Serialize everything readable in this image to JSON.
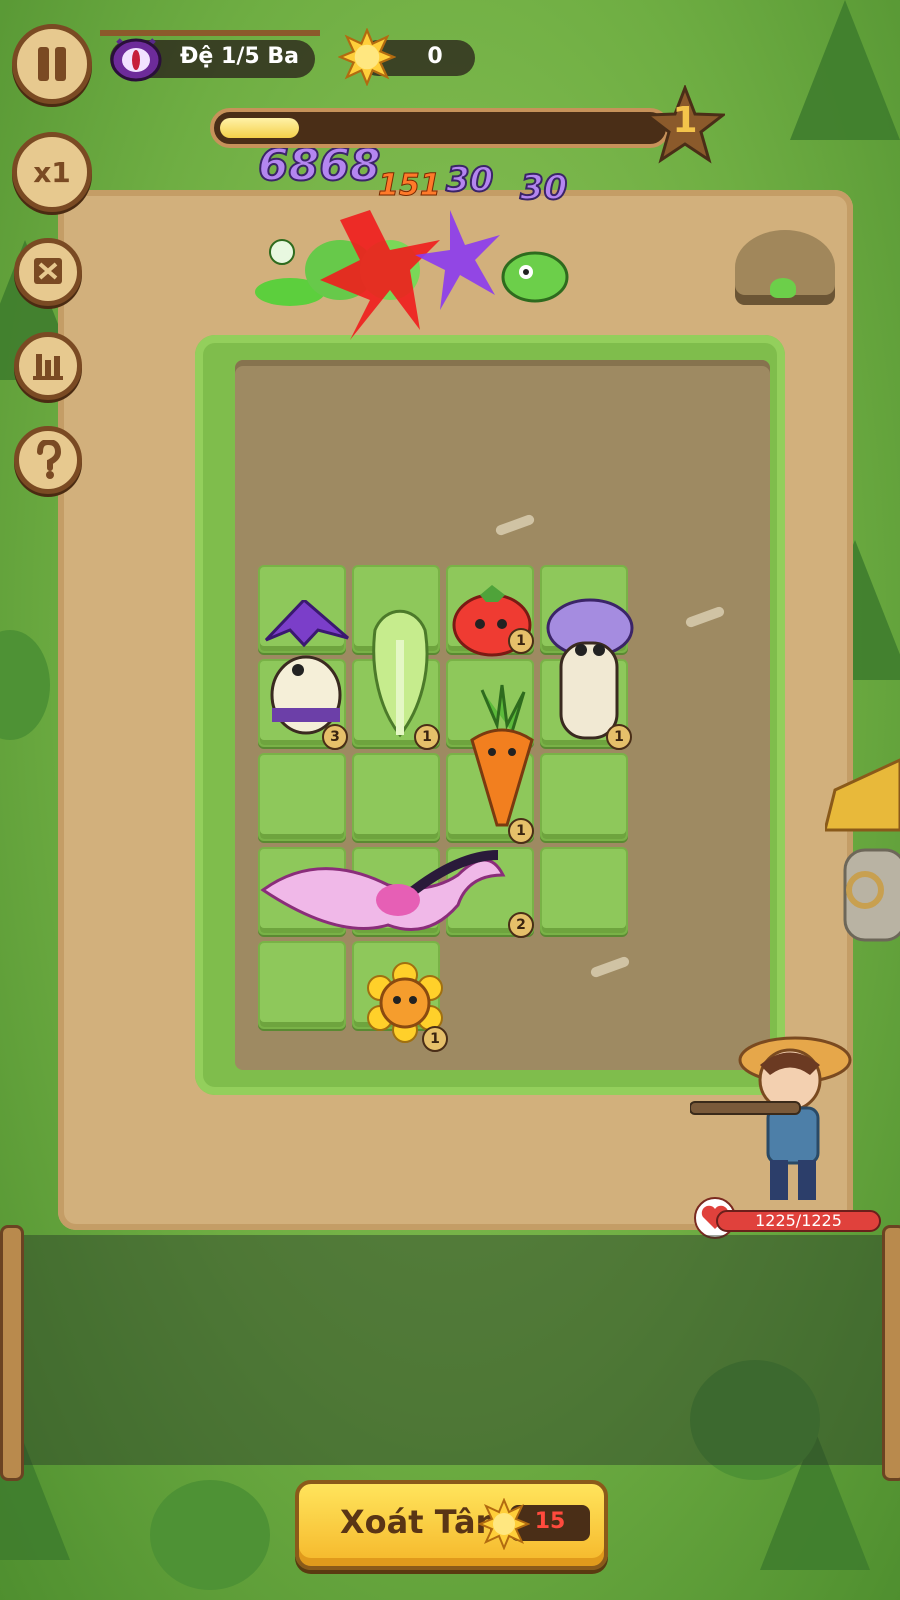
{
  "hud": {
    "stage_label": "Đệ 1/5 Ba",
    "sun_count": "0",
    "wave_number": "1",
    "wave_progress": 0.18,
    "speed_label": "x1"
  },
  "damage_numbers": [
    "6868",
    "151",
    "30",
    "30"
  ],
  "board": {
    "levels": {
      "pirate_mushroom": "3",
      "lettuce": "1",
      "tomato": "1",
      "purple_mushroom": "1",
      "carrot": "1",
      "dragon": "2",
      "sunflower": "1"
    }
  },
  "player": {
    "hp_text": "1225/1225",
    "hp_fraction": 1.0
  },
  "action": {
    "label": "Xoát Tân",
    "cost": "15"
  },
  "colors": {
    "accent": "#f5b72a",
    "hp": "#e0413c",
    "grass": "#8ec85b",
    "damage_purple": "#b486f0",
    "damage_orange": "#ff7a2a"
  }
}
